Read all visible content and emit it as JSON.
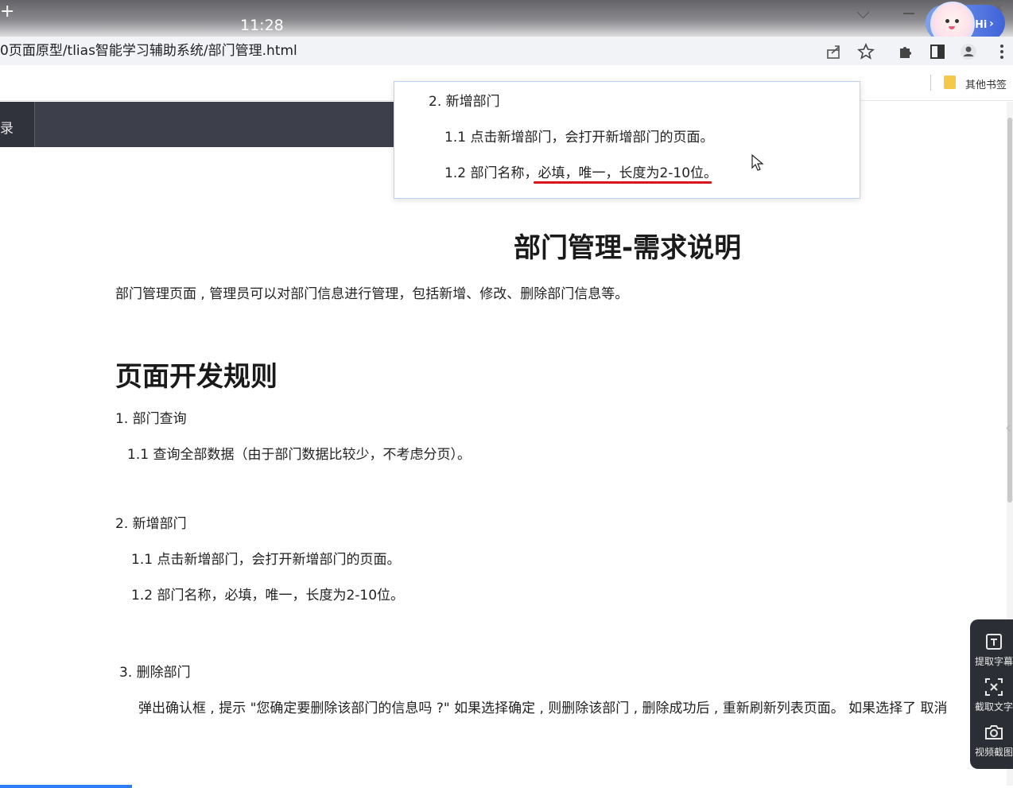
{
  "browser": {
    "clock": "11:28",
    "url": "0页面原型/tlias智能学习辅助系统/部门管理.html",
    "assistant_badge": "Hi",
    "bookmark_folder": "其他书签"
  },
  "nav": {
    "tab_label": "录"
  },
  "tooltip": {
    "heading": "2. 新增部门",
    "item1": "1.1 点击新增部门，会打开新增部门的页面。",
    "item2": "1.2 部门名称，必填，唯一，长度为2-10位。"
  },
  "doc": {
    "title": "部门管理-需求说明",
    "intro": "部门管理页面 , 管理员可以对部门信息进行管理，包括新增、修改、删除部门信息等。",
    "rules_heading": "页面开发规则",
    "s1_heading": "1. 部门查询",
    "s1_item1": "1.1  查询全部数据（由于部门数据比较少，不考虑分页）。",
    "s2_heading": "2. 新增部门",
    "s2_item1": "1.1 点击新增部门，会打开新增部门的页面。",
    "s2_item2": "1.2 部门名称，必填，唯一，长度为2-10位。",
    "s3_heading": "3.  删除部门",
    "s3_text": "弹出确认框 , 提示 \"您确定要删除该部门的信息吗 ?\"  如果选择确定 , 则删除该部门 , 删除成功后 , 重新刷新列表页面。  如果选择了 取消"
  },
  "tools": {
    "subtitle": "提取字幕",
    "ocr": "截取文字",
    "screenshot": "视频截图"
  },
  "colors": {
    "accent_blue": "#2e7cf6",
    "underline_red": "#d9141e",
    "nav_dark": "#3d404a",
    "panel_dark": "#2b2e35"
  }
}
